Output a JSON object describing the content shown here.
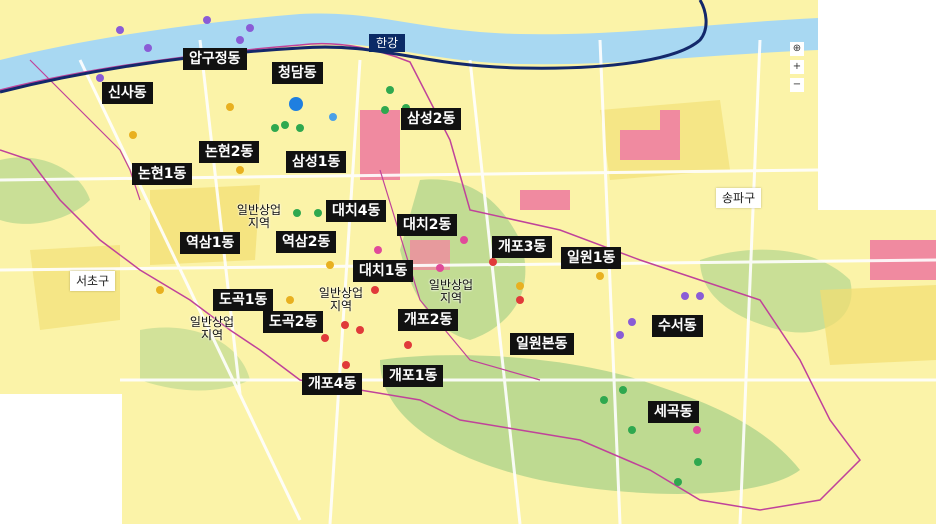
{
  "map": {
    "river_label": "한강",
    "districts": [
      "서초구",
      "송파구"
    ],
    "dongs": [
      "신사동",
      "압구정동",
      "청담동",
      "삼성2동",
      "논현2동",
      "삼성1동",
      "논현1동",
      "대치4동",
      "대치2동",
      "역삼1동",
      "역삼2동",
      "개포3동",
      "일원1동",
      "대치1동",
      "도곡1동",
      "개포2동",
      "도곡2동",
      "수서동",
      "일원본동",
      "개포4동",
      "개포1동",
      "세곡동"
    ],
    "zones": [
      "일반상업 지역",
      "일반상업 지역",
      "일반상업 지역",
      "일반상업 지역"
    ],
    "controls": [
      "compass-icon",
      "zoom-in-icon",
      "zoom-out-icon"
    ],
    "colors": {
      "land": "#fbf3a8",
      "residential_dark": "#f2dd70",
      "commercial": "#f08aa0",
      "green": "#a9d28a",
      "river": "#a8d8f2",
      "boundary": "#c0429a",
      "river_line": "#13286b"
    }
  }
}
